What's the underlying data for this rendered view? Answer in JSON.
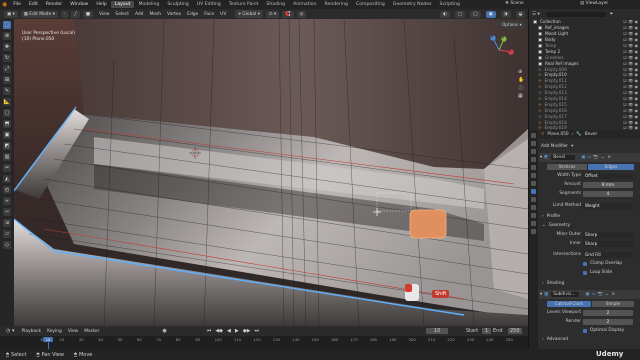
{
  "topbar": {
    "menus": [
      "File",
      "Edit",
      "Render",
      "Window",
      "Help"
    ],
    "workspaces": [
      "Layout",
      "Modeling",
      "Sculpting",
      "UV Editing",
      "Texture Paint",
      "Shading",
      "Animation",
      "Rendering",
      "Compositing",
      "Geometry Nodes",
      "Scripting"
    ],
    "scene": "Scene",
    "view_layer": "ViewLayer"
  },
  "header": {
    "mode": "Edit Mode",
    "menus": [
      "View",
      "Select",
      "Add",
      "Mesh",
      "Vertex",
      "Edge",
      "Face",
      "UV"
    ],
    "orientation": "Global",
    "options": "Options"
  },
  "viewport": {
    "perspective": "User Perspective (Local)",
    "object": "(10) Plane.050",
    "overlay_key": "Shift",
    "gizmo_axes": [
      "X",
      "Y",
      "Z"
    ]
  },
  "timeline": {
    "menus": [
      "Playback",
      "Keying",
      "View",
      "Marker"
    ],
    "current_frame": "10",
    "start_label": "Start",
    "start": "1",
    "end_label": "End",
    "end": "250",
    "ruler_ticks": [
      "10",
      "20",
      "30",
      "40",
      "50",
      "60",
      "70",
      "80",
      "90",
      "100",
      "110",
      "120",
      "130",
      "140",
      "150",
      "160",
      "170",
      "180",
      "190",
      "200",
      "210",
      "220",
      "230",
      "240",
      "250"
    ]
  },
  "statusbar": {
    "items": [
      "Select",
      "Pan View",
      "Move"
    ],
    "watermark": "Udemy"
  },
  "outliner": {
    "rows": [
      {
        "name": "Collection",
        "style": "normal"
      },
      {
        "name": "Ref_images",
        "style": "normal"
      },
      {
        "name": "Mood Light",
        "style": "normal"
      },
      {
        "name": "Body",
        "style": "normal"
      },
      {
        "name": "Temp",
        "style": "dim"
      },
      {
        "name": "Temp 2",
        "style": "normal"
      },
      {
        "name": "Greebles",
        "style": "dim"
      },
      {
        "name": "Real Ref images",
        "style": "normal"
      },
      {
        "name": "Empty.009",
        "style": "dim"
      },
      {
        "name": "Empty.010",
        "style": "normal"
      },
      {
        "name": "Empty.011",
        "style": "dim"
      },
      {
        "name": "Empty.012",
        "style": "dim"
      },
      {
        "name": "Empty.013",
        "style": "dim"
      },
      {
        "name": "Empty.014",
        "style": "dim"
      },
      {
        "name": "Empty.015",
        "style": "dim"
      },
      {
        "name": "Empty.016",
        "style": "dim"
      },
      {
        "name": "Empty.017",
        "style": "dim"
      },
      {
        "name": "Empty.018",
        "style": "dim"
      },
      {
        "name": "Empty.019",
        "style": "dim"
      }
    ]
  },
  "properties": {
    "object_name": "Plane.050",
    "modifier_label": "Bevel",
    "add_modifier": "Add Modifier",
    "bevel": {
      "name": "Bevel",
      "tab_vertices": "Vertices",
      "tab_edges": "Edges",
      "width_type_label": "Width Type",
      "width_type": "Offset",
      "amount_label": "Amount",
      "amount": "8 mm",
      "segments_label": "Segments",
      "segments": "4",
      "limit_method_label": "Limit Method",
      "limit_method": "Weight",
      "profile_label": "Profile",
      "geometry_label": "Geometry",
      "miter_outer_label": "Miter Outer",
      "miter_outer": "Sharp",
      "inner_label": "Inner",
      "inner": "Sharp",
      "intersections_label": "Intersections",
      "intersections": "Grid Fill",
      "clamp_overlap": "Clamp Overlap",
      "loop_slide": "Loop Slide",
      "shading_label": "Shading"
    },
    "subsurf": {
      "name": "Subdivis...",
      "tab_catmull": "Catmull-Clark",
      "tab_simple": "Simple",
      "levels_viewport_label": "Levels Viewport",
      "levels_viewport": "2",
      "render_label": "Render",
      "render": "2",
      "optimal_display": "Optimal Display",
      "advanced_label": "Advanced"
    }
  },
  "colors": {
    "accent": "#4772b3",
    "selected_face": "#e0905e",
    "edge_highlight": "#5fb0ff",
    "red_edge": "#c0392b"
  }
}
